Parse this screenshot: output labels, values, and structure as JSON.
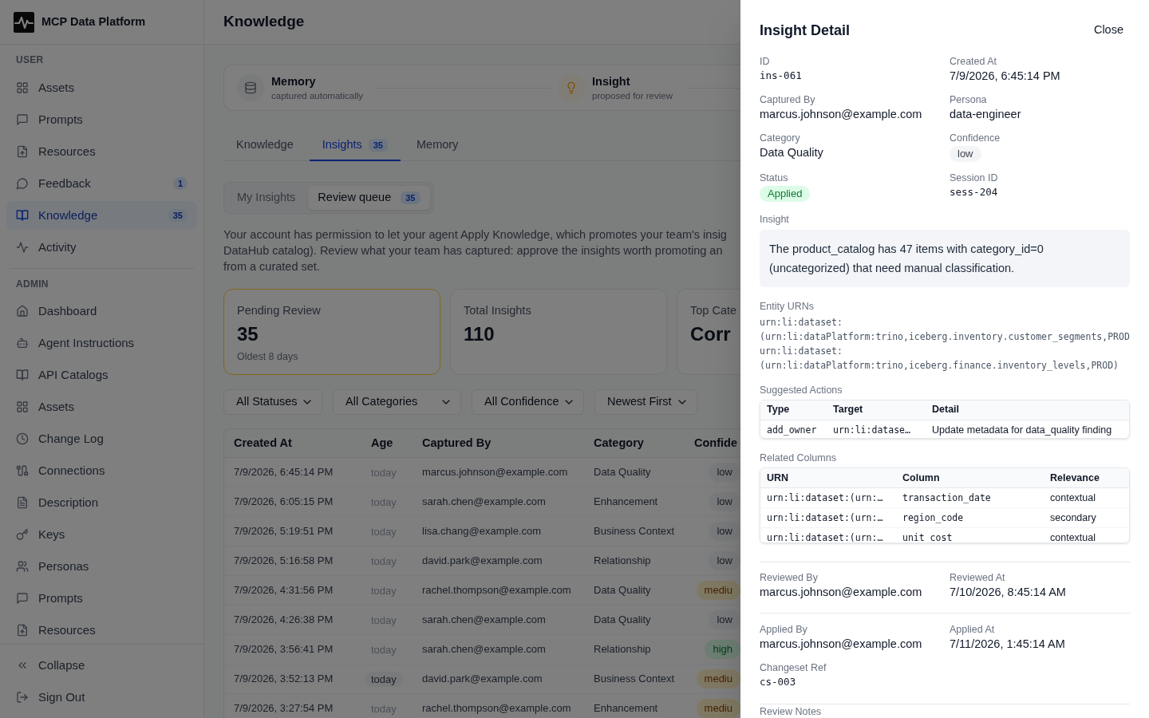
{
  "sidebar": {
    "brand": "MCP Data Platform",
    "sections": [
      {
        "title": "USER",
        "items": [
          {
            "label": "Assets",
            "selected": false
          },
          {
            "label": "Prompts",
            "selected": false
          },
          {
            "label": "Resources",
            "selected": false
          },
          {
            "label": "Feedback",
            "badge": "1",
            "selected": false
          },
          {
            "label": "Knowledge",
            "badge": "35",
            "selected": true
          },
          {
            "label": "Activity",
            "selected": false
          }
        ]
      },
      {
        "title": "ADMIN",
        "items": [
          {
            "label": "Dashboard",
            "selected": false
          },
          {
            "label": "Agent Instructions",
            "selected": false
          },
          {
            "label": "API Catalogs",
            "selected": false
          },
          {
            "label": "Assets",
            "selected": false
          },
          {
            "label": "Change Log",
            "selected": false
          },
          {
            "label": "Connections",
            "selected": false
          },
          {
            "label": "Description",
            "selected": false
          },
          {
            "label": "Keys",
            "selected": false
          },
          {
            "label": "Personas",
            "selected": false
          },
          {
            "label": "Prompts",
            "selected": false
          },
          {
            "label": "Resources",
            "selected": false
          }
        ]
      }
    ],
    "footer_items": [
      {
        "label": "Collapse"
      },
      {
        "label": "Sign Out"
      }
    ]
  },
  "header": {
    "title": "Knowledge"
  },
  "flow_steps": [
    {
      "kind": "memory",
      "title": "Memory",
      "subtitle": "captured automatically"
    },
    {
      "kind": "insight",
      "title": "Insight",
      "subtitle": "proposed for review"
    }
  ],
  "tabs": [
    {
      "label": "Knowledge",
      "selected": false
    },
    {
      "label": "Insights",
      "badge": "35",
      "selected": true
    },
    {
      "label": "Memory",
      "selected": false
    }
  ],
  "subtabs": [
    {
      "label": "My Insights",
      "selected": false
    },
    {
      "label": "Review queue",
      "badge": "35",
      "selected": true
    }
  ],
  "description_lines": [
    "Your account has permission to let your agent Apply Knowledge, which promotes your team's insig",
    "DataHub catalog). Review what your team has captured: approve the insights worth promoting an",
    "from a curated set."
  ],
  "stat_cards": [
    {
      "label": "Pending Review",
      "value": "35",
      "note": "Oldest 8 days",
      "highlighted": true
    },
    {
      "label": "Total Insights",
      "value": "110",
      "highlighted": false
    },
    {
      "label": "Top Cate",
      "value": "Corr",
      "highlighted": false
    }
  ],
  "filters": [
    {
      "value": "All Statuses"
    },
    {
      "value": "All Categories"
    },
    {
      "value": "All Confidence"
    },
    {
      "value": "Newest First"
    }
  ],
  "table": {
    "columns": [
      "Created At",
      "Age",
      "Captured By",
      "Category",
      "Confide"
    ],
    "rows": [
      {
        "created_at": "7/9/2026, 6:45:14 PM",
        "age": "today",
        "age_highlighted": false,
        "captured_by": "marcus.johnson@example.com",
        "category": "Data Quality",
        "confidence": {
          "label": "low",
          "kind": "neutral"
        }
      },
      {
        "created_at": "7/9/2026, 6:05:15 PM",
        "age": "today",
        "age_highlighted": false,
        "captured_by": "sarah.chen@example.com",
        "category": "Enhancement",
        "confidence": {
          "label": "low",
          "kind": "neutral"
        }
      },
      {
        "created_at": "7/9/2026, 5:19:51 PM",
        "age": "today",
        "age_highlighted": false,
        "captured_by": "lisa.chang@example.com",
        "category": "Business Context",
        "confidence": {
          "label": "low",
          "kind": "neutral"
        }
      },
      {
        "created_at": "7/9/2026, 5:16:58 PM",
        "age": "today",
        "age_highlighted": false,
        "captured_by": "david.park@example.com",
        "category": "Relationship",
        "confidence": {
          "label": "low",
          "kind": "neutral"
        }
      },
      {
        "created_at": "7/9/2026, 4:31:56 PM",
        "age": "today",
        "age_highlighted": false,
        "captured_by": "rachel.thompson@example.com",
        "category": "Data Quality",
        "confidence": {
          "label": "mediu",
          "kind": "warning"
        }
      },
      {
        "created_at": "7/9/2026, 4:26:38 PM",
        "age": "today",
        "age_highlighted": false,
        "captured_by": "sarah.chen@example.com",
        "category": "Data Quality",
        "confidence": {
          "label": "low",
          "kind": "neutral"
        }
      },
      {
        "created_at": "7/9/2026, 3:56:41 PM",
        "age": "today",
        "age_highlighted": false,
        "captured_by": "sarah.chen@example.com",
        "category": "Relationship",
        "confidence": {
          "label": "high",
          "kind": "success"
        }
      },
      {
        "created_at": "7/9/2026, 3:52:13 PM",
        "age": "today",
        "age_highlighted": true,
        "captured_by": "david.park@example.com",
        "category": "Business Context",
        "confidence": {
          "label": "mediu",
          "kind": "warning"
        }
      },
      {
        "created_at": "7/9/2026, 3:27:54 PM",
        "age": "today",
        "age_highlighted": false,
        "captured_by": "rachel.thompson@example.com",
        "category": "Enhancement",
        "confidence": {
          "label": "mediu",
          "kind": "warning"
        }
      }
    ]
  },
  "detail": {
    "title": "Insight Detail",
    "close": "Close",
    "fields": [
      {
        "label": "ID",
        "value": "ins-061",
        "kind": "mono"
      },
      {
        "label": "Created At",
        "value": "7/9/2026, 6:45:14 PM",
        "kind": "text"
      },
      {
        "label": "Captured By",
        "value": "marcus.johnson@example.com",
        "kind": "text"
      },
      {
        "label": "Persona",
        "value": "data-engineer",
        "kind": "text"
      },
      {
        "label": "Category",
        "value": "Data Quality",
        "kind": "text"
      },
      {
        "label": "Confidence",
        "value": "low",
        "kind": "badge",
        "color": "#f3f4f6"
      },
      {
        "label": "Status",
        "value": "Applied",
        "kind": "badge",
        "color": "#dcfce7"
      },
      {
        "label": "Session ID",
        "value": "sess-204",
        "kind": "mono"
      }
    ],
    "insight": {
      "label": "Insight",
      "text": "The product_catalog has 47 items with category_id=0 (uncategorized) that need manual classification."
    },
    "entity_urns": {
      "label": "Entity URNs",
      "items": [
        "urn:li:dataset:(urn:li:dataPlatform:trino,iceberg.inventory.customer_segments,PROD",
        "urn:li:dataset:(urn:li:dataPlatform:trino,iceberg.finance.inventory_levels,PROD)"
      ]
    },
    "suggested_actions": {
      "label": "Suggested Actions",
      "columns": [
        {
          "label": "Type",
          "kind": "mono"
        },
        {
          "label": "Target",
          "kind": "mono"
        },
        {
          "label": "Detail",
          "kind": "text"
        }
      ],
      "rows": [
        [
          "add_owner",
          "urn:li:datase…",
          "Update metadata for data_quality finding"
        ]
      ]
    },
    "related_columns": {
      "label": "Related Columns",
      "columns": [
        {
          "label": "URN",
          "kind": "mono"
        },
        {
          "label": "Column",
          "kind": "mono"
        },
        {
          "label": "Relevance",
          "kind": "text"
        }
      ],
      "rows": [
        [
          "urn:li:dataset:(urn:…",
          "transaction_date",
          "contextual"
        ],
        [
          "urn:li:dataset:(urn:…",
          "region_code",
          "secondary"
        ],
        [
          "urn:li:dataset:(urn:…",
          "unit_cost",
          "contextual"
        ]
      ]
    },
    "review_fields": [
      {
        "label": "Reviewed By",
        "value": "marcus.johnson@example.com",
        "kind": "text"
      },
      {
        "label": "Reviewed At",
        "value": "7/10/2026, 8:45:14 AM",
        "kind": "text"
      }
    ],
    "apply_fields": [
      {
        "label": "Applied By",
        "value": "marcus.johnson@example.com",
        "kind": "text"
      },
      {
        "label": "Applied At",
        "value": "7/11/2026, 1:45:14 AM",
        "kind": "text"
      },
      {
        "label": "Changeset Ref",
        "value": "cs-003",
        "kind": "mono"
      }
    ],
    "notes_label": "Review Notes"
  }
}
